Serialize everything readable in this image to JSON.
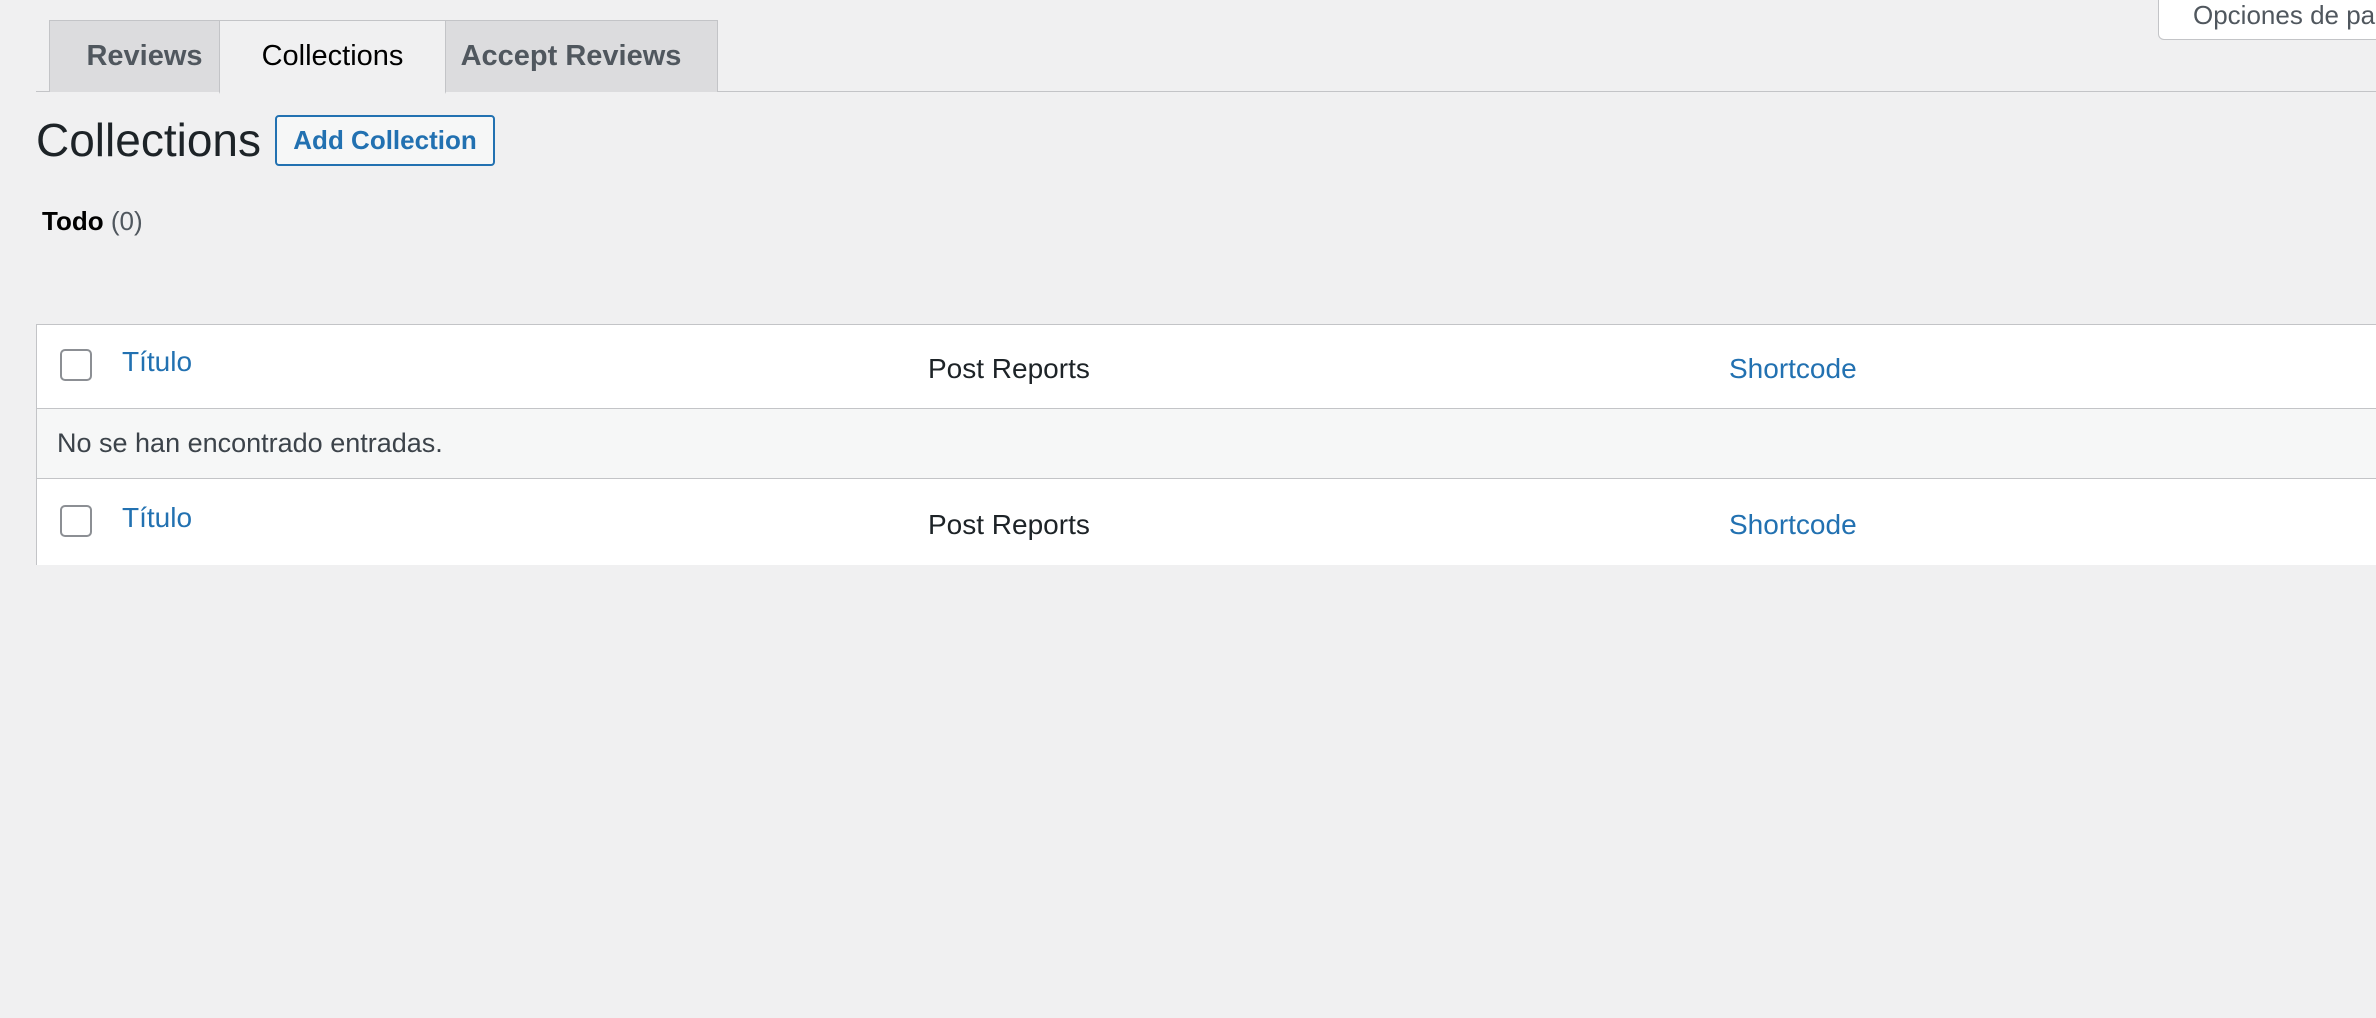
{
  "screen_options": {
    "label": "Opciones de pa"
  },
  "tabs": [
    {
      "label": "Reviews",
      "active": false
    },
    {
      "label": "Collections",
      "active": true
    },
    {
      "label": "Accept Reviews",
      "active": false
    }
  ],
  "header": {
    "title": "Collections",
    "add_button_label": "Add Collection"
  },
  "filters": {
    "current_label": "Todo",
    "current_count": "(0)"
  },
  "table": {
    "columns": {
      "title": "Título",
      "post_reports": "Post Reports",
      "shortcode": "Shortcode"
    },
    "empty_message": "No se han encontrado entradas."
  },
  "colors": {
    "background": "#f0f0f1",
    "link": "#2271b1",
    "border": "#c3c4c7",
    "text": "#1d2327"
  }
}
